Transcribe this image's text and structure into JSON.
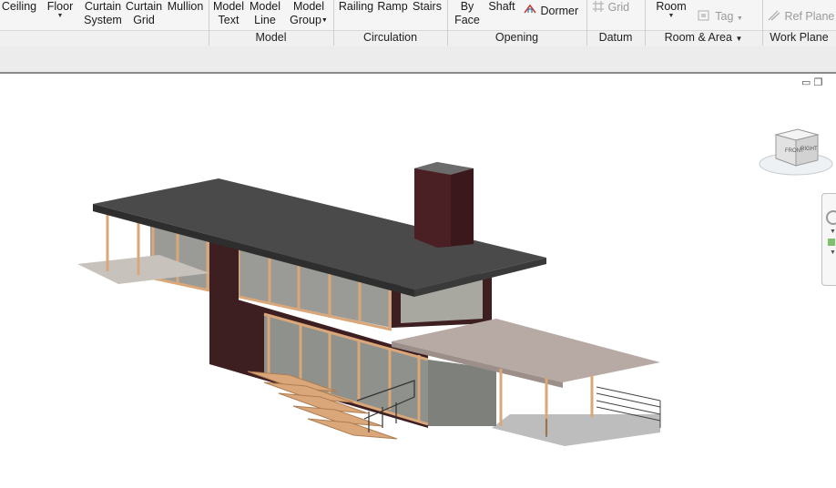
{
  "ribbon": {
    "buttons": {
      "ceiling": "Ceiling",
      "floor": "Floor",
      "curtain_system_1": "Curtain",
      "curtain_system_2": "System",
      "curtain_grid_1": "Curtain",
      "curtain_grid_2": "Grid",
      "mullion": "Mullion",
      "model_text_1": "Model",
      "model_text_2": "Text",
      "model_line_1": "Model",
      "model_line_2": "Line",
      "model_group_1": "Model",
      "model_group_2": "Group",
      "railing": "Railing",
      "ramp": "Ramp",
      "stairs": "Stairs",
      "by_face_1": "By",
      "by_face_2": "Face",
      "shaft": "Shaft",
      "dormer": "Dormer",
      "grid": "Grid",
      "room": "Room",
      "tag": "Tag",
      "ref_plane": "Ref Plane"
    },
    "panels": {
      "model": "Model",
      "circulation": "Circulation",
      "opening": "Opening",
      "datum": "Datum",
      "room_area": "Room & Area",
      "work_plane": "Work Plane"
    }
  },
  "viewcube": {
    "front": "FRONT",
    "right": "RIGHT"
  },
  "colors": {
    "roof": "#4a4a4a",
    "chimney": "#4b2024",
    "brick": "#3d1e21",
    "wood": "#d9a77a",
    "porch_roof": "#b7a9a3",
    "glass": "#8f918c"
  }
}
